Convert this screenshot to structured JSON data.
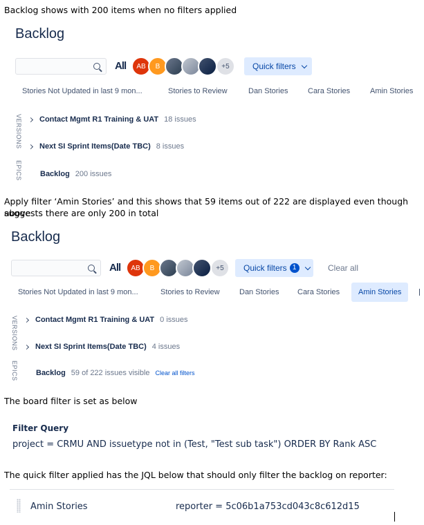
{
  "captions": {
    "c1": "Backlog shows with 200 items when no filters applied",
    "c2_line1": "Apply filter ‘Amin Stories’ and this shows that 59 items out of 222 are displayed even though above",
    "c2_line2": "suggests there are only 200 in total",
    "c3": "The board filter is set as below",
    "c4": "The quick filter applied has the JQL below that should only filter the backlog on reporter:"
  },
  "shot1": {
    "title": "Backlog",
    "all_label": "All",
    "avatars": [
      {
        "initials": "AB",
        "kind": "initials",
        "color": "#de350b"
      },
      {
        "initials": "B",
        "kind": "initials",
        "color": "#ff991f"
      },
      {
        "initials": "",
        "kind": "photo"
      },
      {
        "initials": "",
        "kind": "photo"
      },
      {
        "initials": "",
        "kind": "photo"
      },
      {
        "initials": "+5",
        "kind": "more"
      }
    ],
    "quick_filters_label": "Quick filters",
    "tabs": [
      "Stories Not Updated in last 9 mon...",
      "Stories to Review",
      "Dan Stories",
      "Cara Stories",
      "Amin Stories"
    ],
    "side_versions": "VERSIONS",
    "side_epics": "EPICS",
    "rows": [
      {
        "name": "Contact Mgmt R1 Training & UAT",
        "count": "18 issues"
      },
      {
        "name": "Next SI Sprint Items(Date TBC)",
        "count": "8 issues"
      }
    ],
    "backlog": {
      "name": "Backlog",
      "count": "200 issues"
    }
  },
  "shot2": {
    "title": "Backlog",
    "all_label": "All",
    "quick_filters_label": "Quick filters",
    "quick_filters_count": "1",
    "clear_all": "Clear all",
    "tabs": [
      "Stories Not Updated in last 9 mon...",
      "Stories to Review",
      "Dan Stories",
      "Cara Stories",
      "Amin Stories"
    ],
    "active_tab": "Amin Stories",
    "side_versions": "VERSIONS",
    "side_epics": "EPICS",
    "rows": [
      {
        "name": "Contact Mgmt R1 Training & UAT",
        "count": "0 issues"
      },
      {
        "name": "Next SI Sprint Items(Date TBC)",
        "count": "4 issues"
      }
    ],
    "backlog": {
      "name": "Backlog",
      "count": "59 of 222 issues visible",
      "link": "Clear all filters"
    }
  },
  "filter": {
    "heading": "Filter Query",
    "query": "project = CRMU AND issuetype not in (Test, \"Test sub task\") ORDER BY Rank ASC"
  },
  "quick_filter_row": {
    "name": "Amin Stories",
    "jql": "reporter = 5c06b1a753cd043c8c612d15"
  }
}
